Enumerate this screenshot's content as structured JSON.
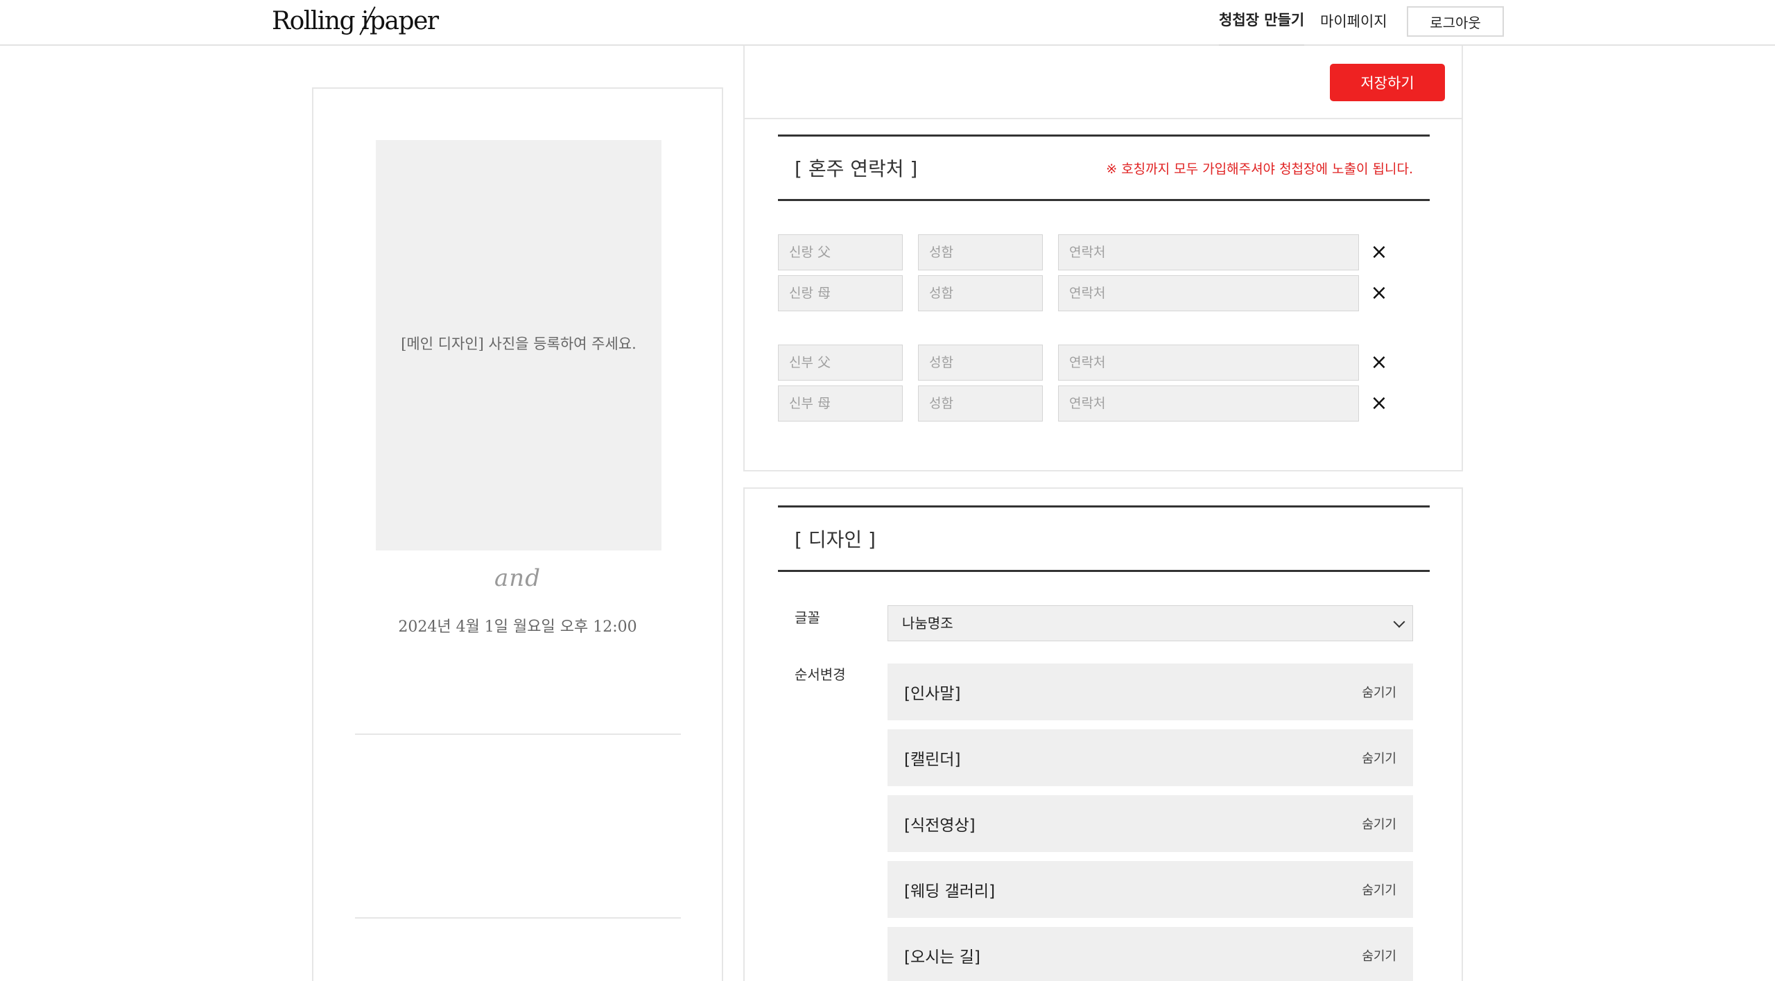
{
  "header": {
    "logo_left": "Rolling i",
    "logo_right": "paper",
    "nav_create": "청첩장 만들기",
    "nav_mypage": "마이페이지",
    "logout": "로그아웃"
  },
  "preview": {
    "photo_placeholder": "[메인 디자인] 사진을 등록하여 주세요.",
    "and_text": "and",
    "date_text": "2024년 4월 1일 월요일 오후 12:00"
  },
  "toolbar": {
    "save_label": "저장하기"
  },
  "contacts": {
    "title": "[ 혼주 연락처 ]",
    "note": "※ 호칭까지 모두 가입해주셔야 청첩장에 노출이 됩니다.",
    "rows": [
      {
        "title_placeholder": "신랑 父",
        "name_placeholder": "성함",
        "phone_placeholder": "연락처"
      },
      {
        "title_placeholder": "신랑 母",
        "name_placeholder": "성함",
        "phone_placeholder": "연락처"
      },
      {
        "title_placeholder": "신부 父",
        "name_placeholder": "성함",
        "phone_placeholder": "연락처"
      },
      {
        "title_placeholder": "신부 母",
        "name_placeholder": "성함",
        "phone_placeholder": "연락처"
      }
    ],
    "remove_icon": "×"
  },
  "design": {
    "title": "[ 디자인 ]",
    "font_label": "글꼴",
    "font_selected": "나눔명조",
    "order_label": "순서변경",
    "order_items": [
      {
        "label": "[인사말]",
        "action": "숨기기"
      },
      {
        "label": "[캘린더]",
        "action": "숨기기"
      },
      {
        "label": "[식전영상]",
        "action": "숨기기"
      },
      {
        "label": "[웨딩 갤러리]",
        "action": "숨기기"
      },
      {
        "label": "[오시는 길]",
        "action": "숨기기"
      }
    ]
  },
  "colors": {
    "accent": "#ee2222",
    "note_red": "#e02222",
    "field_bg": "#f0f0f0",
    "border": "#e6e6e6"
  }
}
